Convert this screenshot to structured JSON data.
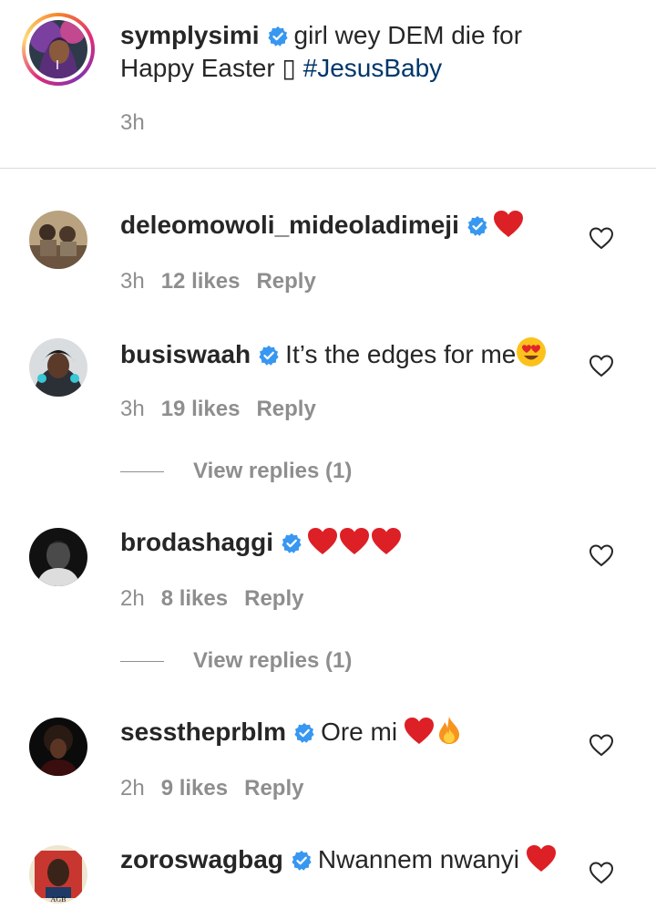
{
  "caption": {
    "username": "symplysimi",
    "text_line1": "girl wey DEM die for",
    "text_line2_prefix": "Happy Easter",
    "glyph": "▯",
    "hashtag": "#JesusBaby",
    "time": "3h"
  },
  "comments": [
    {
      "username": "deleomowoli_mideoladimeji",
      "text": "",
      "emojis": [
        "red-heart"
      ],
      "time": "3h",
      "likes": "12 likes",
      "reply": "Reply"
    },
    {
      "username": "busiswaah",
      "text": "It’s the edges for me",
      "emojis": [
        "heart-eyes"
      ],
      "time": "3h",
      "likes": "19 likes",
      "reply": "Reply",
      "view_replies": "View replies (1)"
    },
    {
      "username": "brodashaggi",
      "text": "",
      "emojis": [
        "red-heart",
        "red-heart",
        "red-heart"
      ],
      "time": "2h",
      "likes": "8 likes",
      "reply": "Reply",
      "view_replies": "View replies (1)"
    },
    {
      "username": "sesstheprblm",
      "text": "Ore mi",
      "emojis": [
        "red-heart",
        "fire"
      ],
      "time": "2h",
      "likes": "9 likes",
      "reply": "Reply"
    },
    {
      "username": "zoroswagbag",
      "text": "Nwannem nwanyi",
      "emojis": [
        "red-heart"
      ],
      "time": "",
      "likes": "",
      "reply": ""
    }
  ],
  "avatar_labels": {
    "zoroswagbag": "AGB"
  },
  "colors": {
    "verified": "#3897f0",
    "hashtag": "#00376b",
    "meta": "#8e8e8e",
    "heart": "#ed4956"
  }
}
